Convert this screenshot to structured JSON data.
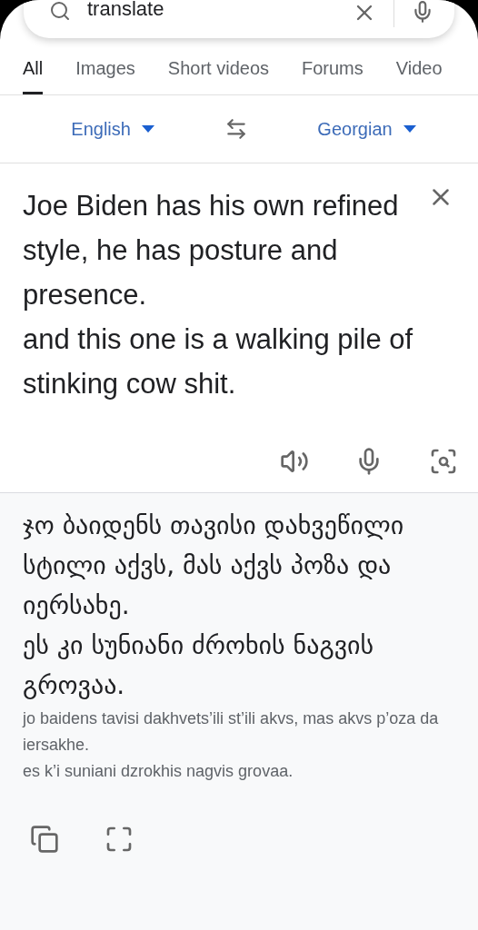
{
  "search": {
    "value": "translate"
  },
  "tabs": [
    {
      "label": "All",
      "selected": true
    },
    {
      "label": "Images",
      "selected": false
    },
    {
      "label": "Short videos",
      "selected": false
    },
    {
      "label": "Forums",
      "selected": false
    },
    {
      "label": "Video",
      "selected": false
    }
  ],
  "languages": {
    "source": "English",
    "target": "Georgian"
  },
  "source_text": "Joe Biden has his own refined style, he has posture and presence.\nand this one is a walking pile of stinking cow shit.",
  "translation": {
    "text": "ჯო ბაიდენს თავისი დახვეწილი სტილი აქვს, მას აქვს პოზა და იერსახე.\nეს კი სუნიანი ძროხის ნაგვის გროვაა.",
    "romanization": "jo baidens tavisi dakhvets’ili st’ili akvs, mas akvs p’oza da iersakhe.\nes k’i suniani dzrokhis nagvis grovaa."
  }
}
